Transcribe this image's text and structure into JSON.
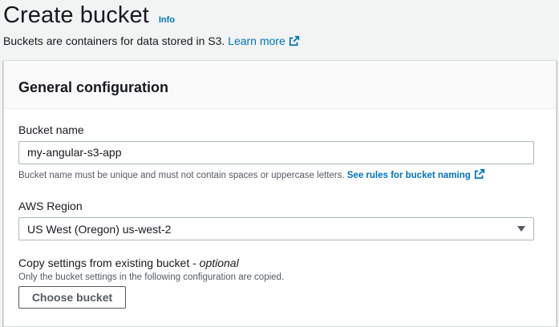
{
  "header": {
    "title": "Create bucket",
    "info_label": "Info",
    "description": "Buckets are containers for data stored in S3. ",
    "learn_more_label": "Learn more"
  },
  "general_config": {
    "title": "General configuration",
    "bucket_name": {
      "label": "Bucket name",
      "value": "my-angular-s3-app",
      "constraint": "Bucket name must be unique and must not contain spaces or uppercase letters. ",
      "rules_link_label": "See rules for bucket naming"
    },
    "region": {
      "label": "AWS Region",
      "selected": "US West (Oregon) us-west-2"
    },
    "copy_settings": {
      "label": "Copy settings from existing bucket - ",
      "optional_label": "optional",
      "description": "Only the bucket settings in the following configuration are copied.",
      "button_label": "Choose bucket"
    }
  },
  "icons": {
    "external_link": "external-link-icon",
    "dropdown_caret": "caret-down-icon"
  },
  "colors": {
    "link": "#0073bb",
    "text": "#16191f",
    "secondary_text": "#545b64",
    "background": "#f2f3f3",
    "border": "#aab7b8"
  }
}
